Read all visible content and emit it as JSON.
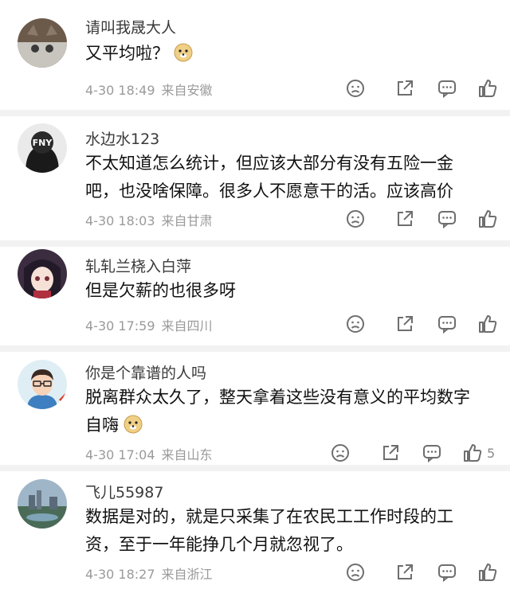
{
  "comments": [
    {
      "user": "请叫我晟大人",
      "lines": [
        "又平均啦？"
      ],
      "emoji": "doge-emoji",
      "time": "4-30 18:49",
      "location": "来自安徽",
      "likes": ""
    },
    {
      "user": "水边水123",
      "lines": [
        "不太知道怎么统计，但应该大部分有没有五险一金",
        "吧，也没啥保障。很多人不愿意干的活。应该高价"
      ],
      "emoji": "",
      "time": "4-30 18:03",
      "location": "来自甘肃",
      "likes": ""
    },
    {
      "user": "轧轧兰桡入白萍",
      "lines": [
        "但是欠薪的也很多呀"
      ],
      "emoji": "",
      "time": "4-30 17:59",
      "location": "来自四川",
      "likes": ""
    },
    {
      "user": "你是个靠谱的人吗",
      "lines": [
        "脱离群众太久了，整天拿着这些没有意义的平均数字",
        "自嗨"
      ],
      "emoji": "doge-emoji",
      "time": "4-30 17:04",
      "location": "来自山东",
      "likes": "5"
    },
    {
      "user": "飞儿55987",
      "lines": [
        "数据是对的，就是只采集了在农民工工作时段的工",
        "资，至于一年能挣几个月就忽视了。"
      ],
      "emoji": "",
      "time": "4-30 18:27",
      "location": "来自浙江",
      "likes": ""
    }
  ],
  "avatar_text": {
    "c2": "FNY"
  },
  "icons": [
    "dislike-icon",
    "share-icon",
    "reply-icon",
    "like-icon"
  ],
  "colors": {
    "meta": "#9a9a9a",
    "separator": "#f2f2f2",
    "icon": "#6e6e6e"
  }
}
